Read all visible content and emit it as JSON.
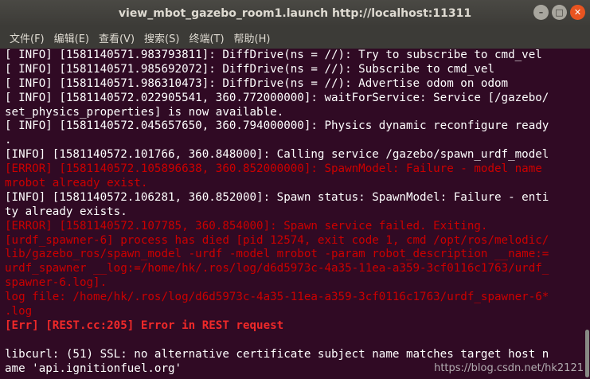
{
  "window": {
    "title": "view_mbot_gazebo_room1.launch http://localhost:11311",
    "controls": {
      "minimize": "–",
      "maximize": "□",
      "close": "✕"
    }
  },
  "menu": [
    "文件(F)",
    "编辑(E)",
    "查看(V)",
    "搜索(S)",
    "终端(T)",
    "帮助(H)"
  ],
  "terminal": {
    "lines": [
      {
        "type": "info",
        "text": "[ INFO] [1581140571.983793811]: DiffDrive(ns = //): Try to subscribe to cmd_vel"
      },
      {
        "type": "info",
        "text": "[ INFO] [1581140571.985692072]: DiffDrive(ns = //): Subscribe to cmd_vel"
      },
      {
        "type": "info",
        "text": "[ INFO] [1581140571.986310473]: DiffDrive(ns = //): Advertise odom on odom"
      },
      {
        "type": "info",
        "text": "[ INFO] [1581140572.022905541, 360.772000000]: waitForService: Service [/gazebo/"
      },
      {
        "type": "info",
        "text": "set_physics_properties] is now available."
      },
      {
        "type": "info",
        "text": "[ INFO] [1581140572.045657650, 360.794000000]: Physics dynamic reconfigure ready"
      },
      {
        "type": "info",
        "text": "."
      },
      {
        "type": "info",
        "text": "[INFO] [1581140572.101766, 360.848000]: Calling service /gazebo/spawn_urdf_model"
      },
      {
        "type": "error",
        "text": "[ERROR] [1581140572.105896638, 360.852000000]: SpawnModel: Failure - model name"
      },
      {
        "type": "error",
        "text": "mrobot already exist."
      },
      {
        "type": "info",
        "text": "[INFO] [1581140572.106281, 360.852000]: Spawn status: SpawnModel: Failure - enti"
      },
      {
        "type": "info",
        "text": "ty already exists."
      },
      {
        "type": "error",
        "text": "[ERROR] [1581140572.107785, 360.854000]: Spawn service failed. Exiting."
      },
      {
        "type": "error",
        "text": "[urdf_spawner-6] process has died [pid 12574, exit code 1, cmd /opt/ros/melodic/"
      },
      {
        "type": "error",
        "text": "lib/gazebo_ros/spawn_model -urdf -model mrobot -param robot_description __name:="
      },
      {
        "type": "error",
        "text": "urdf_spawner __log:=/home/hk/.ros/log/d6d5973c-4a35-11ea-a359-3cf0116c1763/urdf_"
      },
      {
        "type": "error",
        "text": "spawner-6.log]."
      },
      {
        "type": "error",
        "text": "log file: /home/hk/.ros/log/d6d5973c-4a35-11ea-a359-3cf0116c1763/urdf_spawner-6*"
      },
      {
        "type": "error",
        "text": ".log"
      },
      {
        "type": "err-bold",
        "text": "[Err] [REST.cc:205] Error in REST request"
      },
      {
        "type": "blank",
        "text": ""
      },
      {
        "type": "info",
        "text": "libcurl: (51) SSL: no alternative certificate subject name matches target host n"
      },
      {
        "type": "info",
        "text": "ame 'api.ignitionfuel.org'"
      }
    ]
  },
  "watermark": "https://blog.csdn.net/hk2121",
  "colors": {
    "background": "#300a24",
    "info_text": "#ffffff",
    "error_text": "#cc0000",
    "titlebar": "#3c3b37",
    "close_button": "#e95420"
  }
}
